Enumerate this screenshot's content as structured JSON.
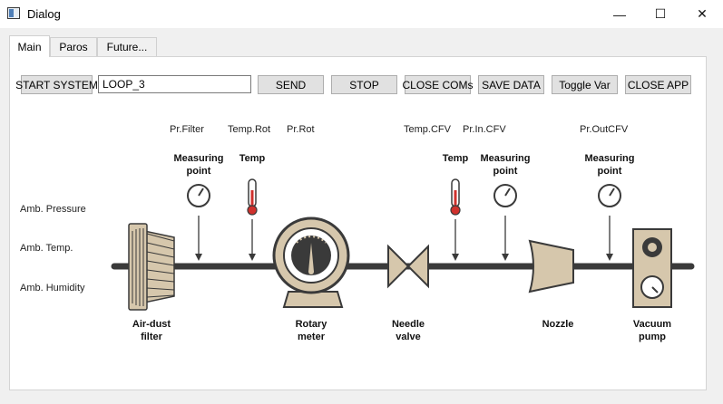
{
  "window": {
    "title": "Dialog",
    "minimize_glyph": "—",
    "maximize_glyph": "☐",
    "close_glyph": "✕"
  },
  "tabs": [
    {
      "label": "Main",
      "active": true
    },
    {
      "label": "Paros",
      "active": false
    },
    {
      "label": "Future...",
      "active": false
    }
  ],
  "toolbar": {
    "start_label": "START SYSTEM",
    "command_value": "LOOP_3",
    "send_label": "SEND",
    "stop_label": "STOP",
    "close_coms_label": "CLOSE COMs",
    "save_data_label": "SAVE DATA",
    "toggle_var_label": "Toggle Var",
    "close_app_label": "CLOSE APP"
  },
  "readouts": {
    "pr_filter": "Pr.Filter",
    "temp_rot": "Temp.Rot",
    "pr_rot": "Pr.Rot",
    "temp_cfv": "Temp.CFV",
    "pr_in_cfv": "Pr.In.CFV",
    "pr_out_cfv": "Pr.OutCFV"
  },
  "ambient": {
    "pressure": "Amb. Pressure",
    "temp": "Amb. Temp.",
    "humidity": "Amb. Humidity"
  },
  "sensors": {
    "measuring_point_1": "Measuring point",
    "temp_1": "Temp",
    "temp_2": "Temp",
    "measuring_point_2": "Measuring point",
    "measuring_point_3": "Measuring point"
  },
  "components": {
    "air_dust_filter": "Air-dust filter",
    "rotary_meter": "Rotary meter",
    "needle_valve": "Needle valve",
    "nozzle": "Nozzle",
    "vacuum_pump": "Vacuum pump"
  },
  "colors": {
    "component_fill": "#d6c7ac",
    "pipe": "#3a3a3a",
    "thermometer_red": "#d0312d",
    "button_face": "#e1e1e1"
  }
}
